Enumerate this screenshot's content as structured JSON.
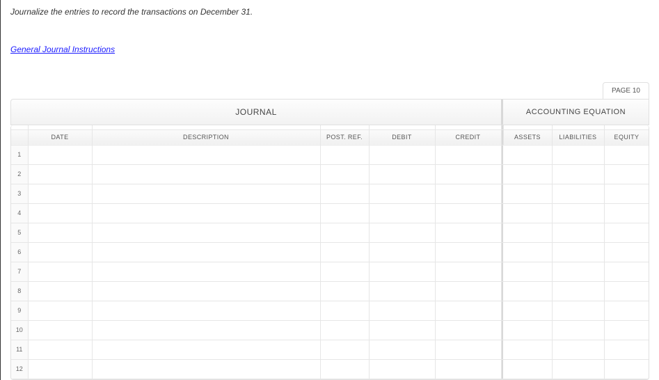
{
  "instruction": "Journalize the entries to record the transactions on December 31.",
  "link_text": "General Journal Instructions",
  "page_label": "PAGE 10",
  "header": {
    "journal": "JOURNAL",
    "equation": "ACCOUNTING EQUATION"
  },
  "columns": {
    "num": "",
    "date": "DATE",
    "description": "DESCRIPTION",
    "post_ref": "POST. REF.",
    "debit": "DEBIT",
    "credit": "CREDIT",
    "assets": "ASSETS",
    "liabilities": "LIABILITIES",
    "equity": "EQUITY"
  },
  "rows": [
    {
      "n": "1",
      "date": "",
      "description": "",
      "post_ref": "",
      "debit": "",
      "credit": "",
      "assets": "",
      "liabilities": "",
      "equity": ""
    },
    {
      "n": "2",
      "date": "",
      "description": "",
      "post_ref": "",
      "debit": "",
      "credit": "",
      "assets": "",
      "liabilities": "",
      "equity": ""
    },
    {
      "n": "3",
      "date": "",
      "description": "",
      "post_ref": "",
      "debit": "",
      "credit": "",
      "assets": "",
      "liabilities": "",
      "equity": ""
    },
    {
      "n": "4",
      "date": "",
      "description": "",
      "post_ref": "",
      "debit": "",
      "credit": "",
      "assets": "",
      "liabilities": "",
      "equity": ""
    },
    {
      "n": "5",
      "date": "",
      "description": "",
      "post_ref": "",
      "debit": "",
      "credit": "",
      "assets": "",
      "liabilities": "",
      "equity": ""
    },
    {
      "n": "6",
      "date": "",
      "description": "",
      "post_ref": "",
      "debit": "",
      "credit": "",
      "assets": "",
      "liabilities": "",
      "equity": ""
    },
    {
      "n": "7",
      "date": "",
      "description": "",
      "post_ref": "",
      "debit": "",
      "credit": "",
      "assets": "",
      "liabilities": "",
      "equity": ""
    },
    {
      "n": "8",
      "date": "",
      "description": "",
      "post_ref": "",
      "debit": "",
      "credit": "",
      "assets": "",
      "liabilities": "",
      "equity": ""
    },
    {
      "n": "9",
      "date": "",
      "description": "",
      "post_ref": "",
      "debit": "",
      "credit": "",
      "assets": "",
      "liabilities": "",
      "equity": ""
    },
    {
      "n": "10",
      "date": "",
      "description": "",
      "post_ref": "",
      "debit": "",
      "credit": "",
      "assets": "",
      "liabilities": "",
      "equity": ""
    },
    {
      "n": "11",
      "date": "",
      "description": "",
      "post_ref": "",
      "debit": "",
      "credit": "",
      "assets": "",
      "liabilities": "",
      "equity": ""
    },
    {
      "n": "12",
      "date": "",
      "description": "",
      "post_ref": "",
      "debit": "",
      "credit": "",
      "assets": "",
      "liabilities": "",
      "equity": ""
    }
  ]
}
